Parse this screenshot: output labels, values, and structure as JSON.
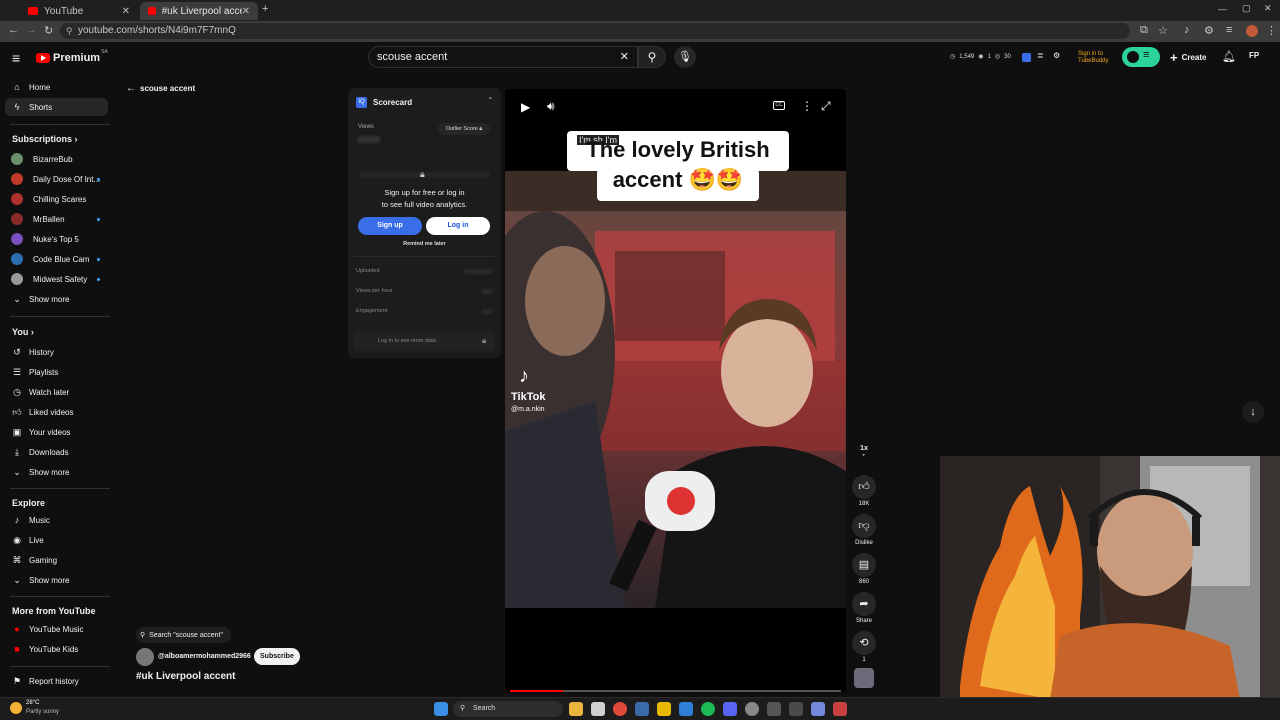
{
  "browser": {
    "tabs": [
      {
        "title": "YouTube",
        "active": false
      },
      {
        "title": "#uk Liverpool accent - YouTube",
        "active": true
      }
    ],
    "url": "youtube.com/shorts/N4i9m7F7mnQ"
  },
  "masthead": {
    "logo_text": "Premium",
    "logo_badge": "SA",
    "search_value": "scouse accent",
    "counter_views": "1,549",
    "counter_2": "1",
    "counter_3": "30",
    "signin_text": "Sign in to TubeBuddy",
    "create_label": "Create",
    "avatar_initials": "FP"
  },
  "back_nav": {
    "label": "scouse accent"
  },
  "sidebar": {
    "main": [
      {
        "label": "Home",
        "icon": "home-icon"
      },
      {
        "label": "Shorts",
        "icon": "shorts-icon",
        "active": true
      }
    ],
    "subscriptions_title": "Subscriptions",
    "subscriptions": [
      {
        "label": "BizarreBub",
        "color": "#6b8f6b",
        "dot": false
      },
      {
        "label": "Daily Dose Of Int...",
        "color": "#c0392b",
        "dot": true
      },
      {
        "label": "Chilling Scares",
        "color": "#b03030",
        "dot": false
      },
      {
        "label": "MrBallen",
        "color": "#8a2b2b",
        "dot": true
      },
      {
        "label": "Nuke's Top 5",
        "color": "#7a4fbf",
        "dot": false
      },
      {
        "label": "Code Blue Cam",
        "color": "#2c6fb0",
        "dot": true
      },
      {
        "label": "Midwest Safety",
        "color": "#999999",
        "dot": true
      }
    ],
    "show_more_1": "Show more",
    "you_title": "You",
    "you_items": [
      {
        "label": "History",
        "icon": "history-icon"
      },
      {
        "label": "Playlists",
        "icon": "playlists-icon"
      },
      {
        "label": "Watch later",
        "icon": "watch-later-icon"
      },
      {
        "label": "Liked videos",
        "icon": "liked-videos-icon"
      },
      {
        "label": "Your videos",
        "icon": "your-videos-icon"
      },
      {
        "label": "Downloads",
        "icon": "downloads-icon"
      }
    ],
    "show_more_2": "Show more",
    "explore_title": "Explore",
    "explore_items": [
      {
        "label": "Music",
        "icon": "music-icon"
      },
      {
        "label": "Live",
        "icon": "live-icon"
      },
      {
        "label": "Gaming",
        "icon": "gaming-icon"
      }
    ],
    "show_more_3": "Show more",
    "more_title": "More from YouTube",
    "more_items": [
      {
        "label": "YouTube Music",
        "icon": "youtube-music-icon"
      },
      {
        "label": "YouTube Kids",
        "icon": "youtube-kids-icon"
      }
    ],
    "report": "Report history"
  },
  "scorecard": {
    "title": "Scorecard",
    "views_label": "Views",
    "outlier_label": "Outlier Score",
    "signup_text_1": "Sign up for free or log in",
    "signup_text_2": "to see full video analytics.",
    "signup_btn": "Sign up",
    "login_btn": "Log in",
    "remind": "Remind me later",
    "uploaded": "Uploaded",
    "views_per_hour": "Views per hour",
    "engagement": "Engagement",
    "login_more": "Log in to see more data"
  },
  "player": {
    "caption_small": "I'm sh I'm",
    "caption_line1": "The lovely British",
    "caption_line2": "accent 🤩🤩",
    "tiktok_label": "TikTok",
    "tiktok_handle": "@m.a.nkin",
    "progress": 0.16
  },
  "actions": {
    "speed": "1x",
    "likes": "18K",
    "dislike": "Dislike",
    "comments": "860",
    "share": "Share",
    "remix_count": "1"
  },
  "below_video": {
    "search_chip": "Search \"scouse accent\"",
    "channel": "@alboamermohammed2966",
    "subscribe": "Subscribe",
    "title": "#uk Liverpool accent"
  },
  "taskbar": {
    "weather_temp": "28°C",
    "weather_desc": "Partly sunny",
    "search_label": "Search"
  }
}
